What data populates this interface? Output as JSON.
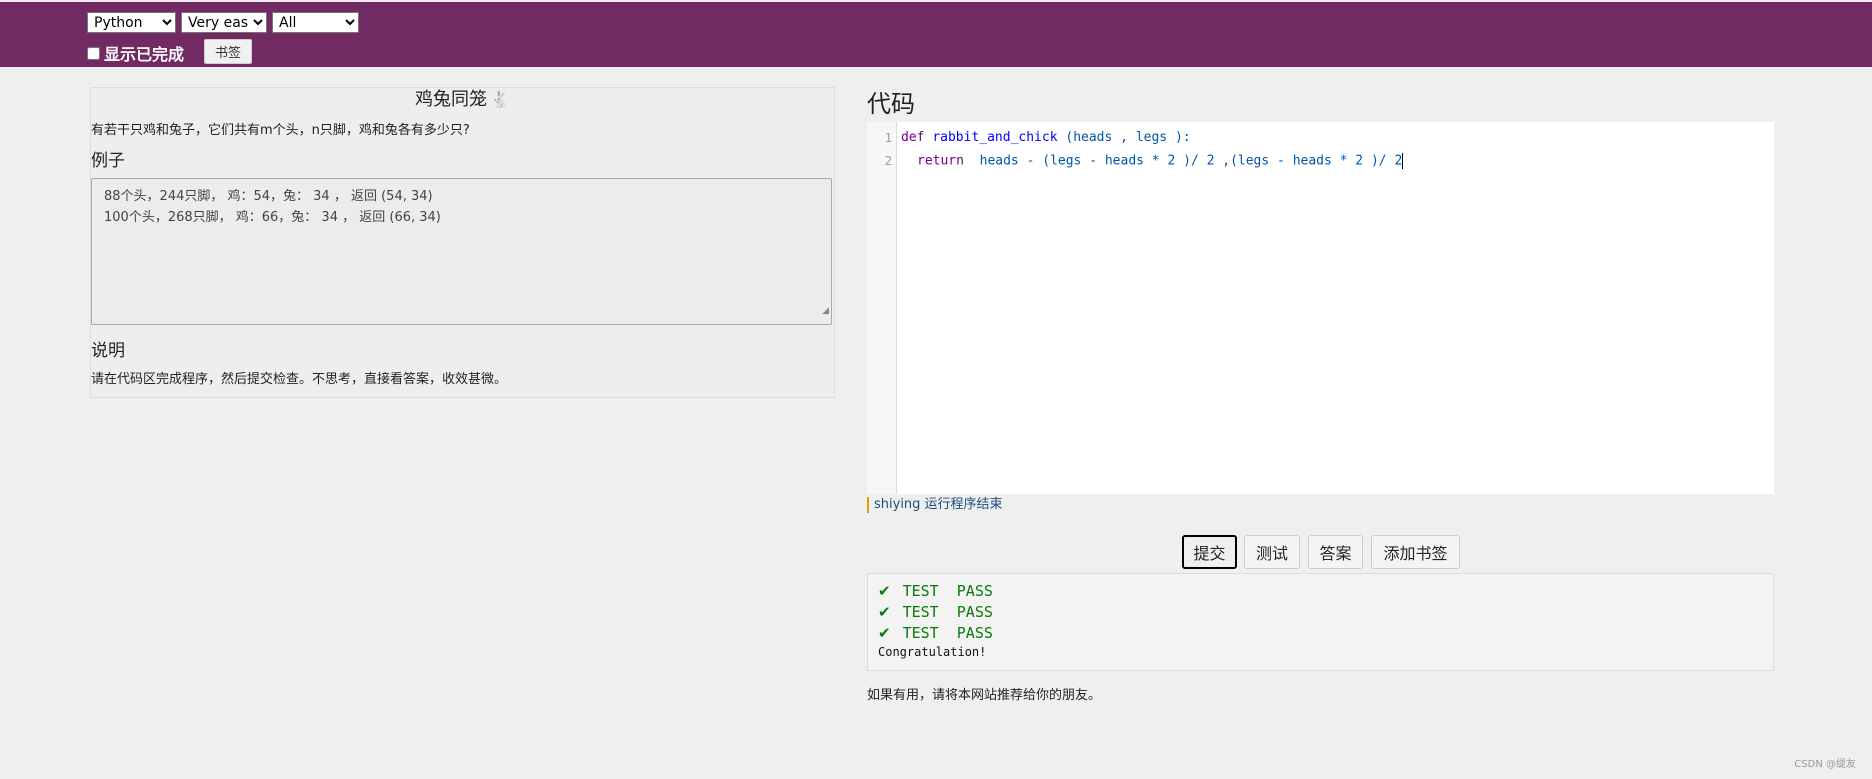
{
  "topbar": {
    "language": "Python",
    "difficulty": "Very easy",
    "filter": "All",
    "show_done_label": "显示已完成",
    "bookmark_label": "书签"
  },
  "problem": {
    "title": "鸡兔同笼",
    "title_icon": "rabbit-icon",
    "description": "有若干只鸡和兔子，它们共有m个头，n只脚，鸡和兔各有多少只?",
    "example_label": "例子",
    "examples": [
      "88个头，244只脚， 鸡：54，兔： 34 ， 返回 (54, 34)",
      "100个头，268只脚， 鸡：66，兔： 34 ， 返回 (66, 34)"
    ],
    "note_label": "说明",
    "note": "请在代码区完成程序，然后提交检查。不思考，直接看答案，收效甚微。"
  },
  "code": {
    "heading": "代码",
    "line_numbers": [
      "1",
      "2"
    ],
    "line1": {
      "kw": "def",
      "name": "rabbit_and_chick",
      "rest": " (heads , legs ):"
    },
    "line2": {
      "kw": "return",
      "rest": "heads - (legs - heads * 2 )/ 2 ,(legs - heads * 2 )/ 2"
    }
  },
  "status": "shiying 运行程序结束",
  "buttons": {
    "submit": "提交",
    "test": "测试",
    "answer": "答案",
    "add_bookmark": "添加书签"
  },
  "results": [
    "TEST  PASS",
    "TEST  PASS",
    "TEST  PASS"
  ],
  "congrats": "Congratulation!",
  "recommend": "如果有用，请将本网站推荐给你的朋友。",
  "footer": "CSDN @缇友",
  "colors": {
    "topbar": "#722b62",
    "pass": "#0a7a0a",
    "background": "#edf0ef"
  }
}
